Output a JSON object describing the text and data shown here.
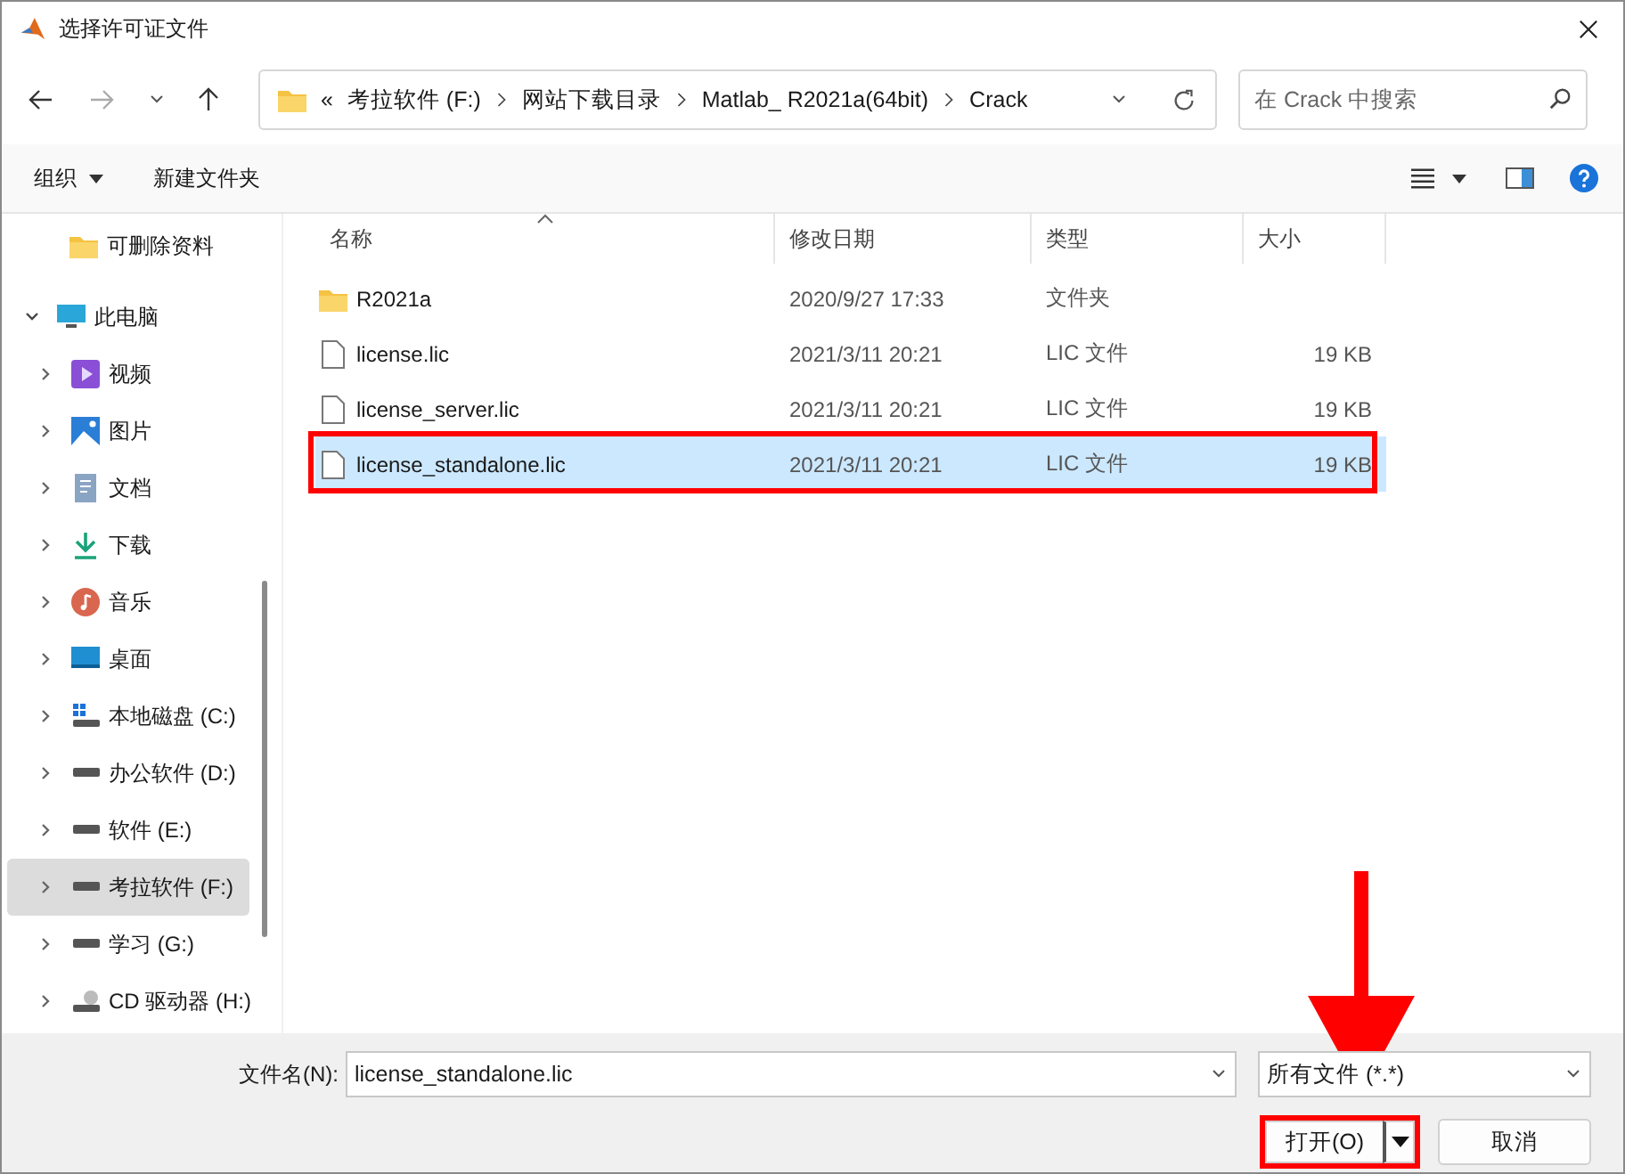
{
  "window": {
    "title": "选择许可证文件"
  },
  "address_bar": {
    "overflow": "«",
    "crumbs": [
      "考拉软件 (F:)",
      "网站下载目录",
      "Matlab_ R2021a(64bit)",
      "Crack"
    ]
  },
  "search": {
    "placeholder": "在 Crack 中搜索"
  },
  "toolbar": {
    "organize": "组织",
    "new_folder": "新建文件夹"
  },
  "sidebar": {
    "items": [
      {
        "label": "可删除资料",
        "kind": "folder",
        "selected": false
      },
      {
        "label": "此电脑",
        "kind": "pc",
        "selected": false,
        "expanded": true,
        "children": [
          {
            "label": "视频",
            "kind": "video",
            "selected": false,
            "expanded": false
          },
          {
            "label": "图片",
            "kind": "pictures",
            "selected": false,
            "expanded": false
          },
          {
            "label": "文档",
            "kind": "documents",
            "selected": false,
            "expanded": false
          },
          {
            "label": "下载",
            "kind": "download",
            "selected": false,
            "expanded": false
          },
          {
            "label": "音乐",
            "kind": "music",
            "selected": false,
            "expanded": false
          },
          {
            "label": "桌面",
            "kind": "desktop",
            "selected": false,
            "expanded": false
          },
          {
            "label": "本地磁盘 (C:)",
            "kind": "system-drive",
            "selected": false,
            "expanded": false
          },
          {
            "label": "办公软件 (D:)",
            "kind": "drive",
            "selected": false,
            "expanded": false
          },
          {
            "label": "软件 (E:)",
            "kind": "drive",
            "selected": false,
            "expanded": false
          },
          {
            "label": "考拉软件 (F:)",
            "kind": "drive",
            "selected": true,
            "expanded": false
          },
          {
            "label": "学习 (G:)",
            "kind": "drive",
            "selected": false,
            "expanded": false
          },
          {
            "label": "CD 驱动器 (H:)",
            "kind": "cd",
            "selected": false,
            "expanded": false
          }
        ]
      }
    ]
  },
  "table": {
    "columns": [
      {
        "label": "名称",
        "sorted": true
      },
      {
        "label": "修改日期",
        "sorted": false
      },
      {
        "label": "类型",
        "sorted": false
      },
      {
        "label": "大小",
        "sorted": false
      }
    ],
    "rows": [
      {
        "kind": "folder",
        "name": "R2021a",
        "date": "2020/9/27 17:33",
        "type": "文件夹",
        "selected": false
      },
      {
        "kind": "file",
        "name": "license.lic",
        "date": "2021/3/11 20:21",
        "type": "LIC 文件",
        "size": "19 KB",
        "selected": false
      },
      {
        "kind": "file",
        "name": "license_server.lic",
        "date": "2021/3/11 20:21",
        "type": "LIC 文件",
        "size": "19 KB",
        "selected": false
      },
      {
        "kind": "file",
        "name": "license_standalone.lic",
        "date": "2021/3/11 20:21",
        "type": "LIC 文件",
        "size": "19 KB",
        "selected": true
      }
    ]
  },
  "footer": {
    "filename_label": "文件名(N):",
    "filename": "license_standalone.lic",
    "filter": "所有文件 (*.*)",
    "open_button": "打开(O)",
    "cancel_button": "取消"
  }
}
